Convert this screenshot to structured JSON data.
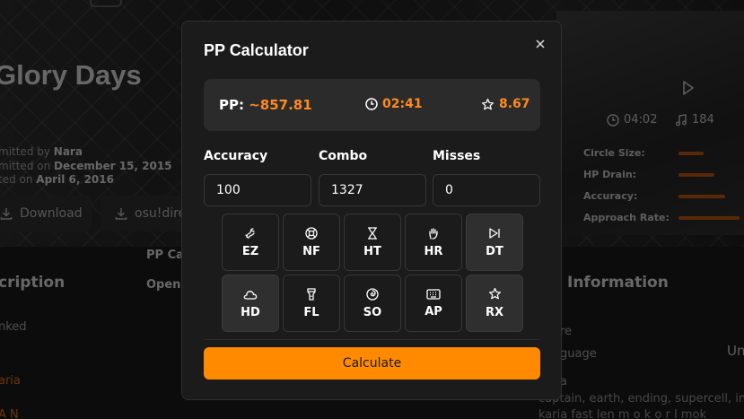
{
  "background": {
    "title": "Glory Days",
    "submitted_by_prefix": "mitted by ",
    "submitted_by": "Nara",
    "submitted_on_prefix": "mitted on ",
    "submitted_on": "December 15, 2015",
    "updated_on_prefix": "ted on ",
    "updated_on": "April 6, 2016",
    "download_label": "Download",
    "direct_label": "osu!dire",
    "pp_calc_partial": "PP Ca",
    "open_partial": "Open",
    "description_heading": "cription",
    "ranked_partial": "nked",
    "orange_text_1": "aria",
    "orange_text_2": "A N",
    "info_heading": "Information",
    "genre_partial": "re",
    "language_partial": "guage",
    "language_value_partial": "Un",
    "tags_partial": "a",
    "tags_line1": "captain, earth, ending, supercell, in",
    "tags_line2": "karia fast len m o k o r I mok",
    "length": "04:02",
    "bpm": "184",
    "stats": [
      {
        "label": "Circle Size:",
        "fraction": 0.35
      },
      {
        "label": "HP Drain:",
        "fraction": 0.5
      },
      {
        "label": "Accuracy:",
        "fraction": 0.65
      },
      {
        "label": "Approach Rate:",
        "fraction": 0.85
      }
    ]
  },
  "modal": {
    "title": "PP Calculator",
    "pp_label": "PP:",
    "pp_value": "~857.81",
    "time": "02:41",
    "stars": "8.67",
    "accuracy_label": "Accuracy",
    "accuracy_value": "100",
    "combo_label": "Combo",
    "combo_value": "1327",
    "misses_label": "Misses",
    "misses_value": "0",
    "mods": [
      {
        "code": "EZ",
        "icon": "easy-icon",
        "active": false
      },
      {
        "code": "NF",
        "icon": "lifebuoy-icon",
        "active": false
      },
      {
        "code": "HT",
        "icon": "hourglass-icon",
        "active": false
      },
      {
        "code": "HR",
        "icon": "hand-rock-icon",
        "active": false
      },
      {
        "code": "DT",
        "icon": "skip-forward-icon",
        "active": true
      },
      {
        "code": "HD",
        "icon": "cloud-icon",
        "active": true
      },
      {
        "code": "FL",
        "icon": "flashlight-icon",
        "active": false
      },
      {
        "code": "SO",
        "icon": "spin-icon",
        "active": false
      },
      {
        "code": "AP",
        "icon": "keyboard-icon",
        "active": false
      },
      {
        "code": "RX",
        "icon": "star-icon",
        "active": true
      }
    ],
    "calculate_label": "Calculate"
  },
  "colors": {
    "accent": "#ff8a00",
    "accent_text": "#ff8a1f",
    "modal_bg": "#1b1b1b",
    "panel_bg": "#2b2b2b"
  }
}
